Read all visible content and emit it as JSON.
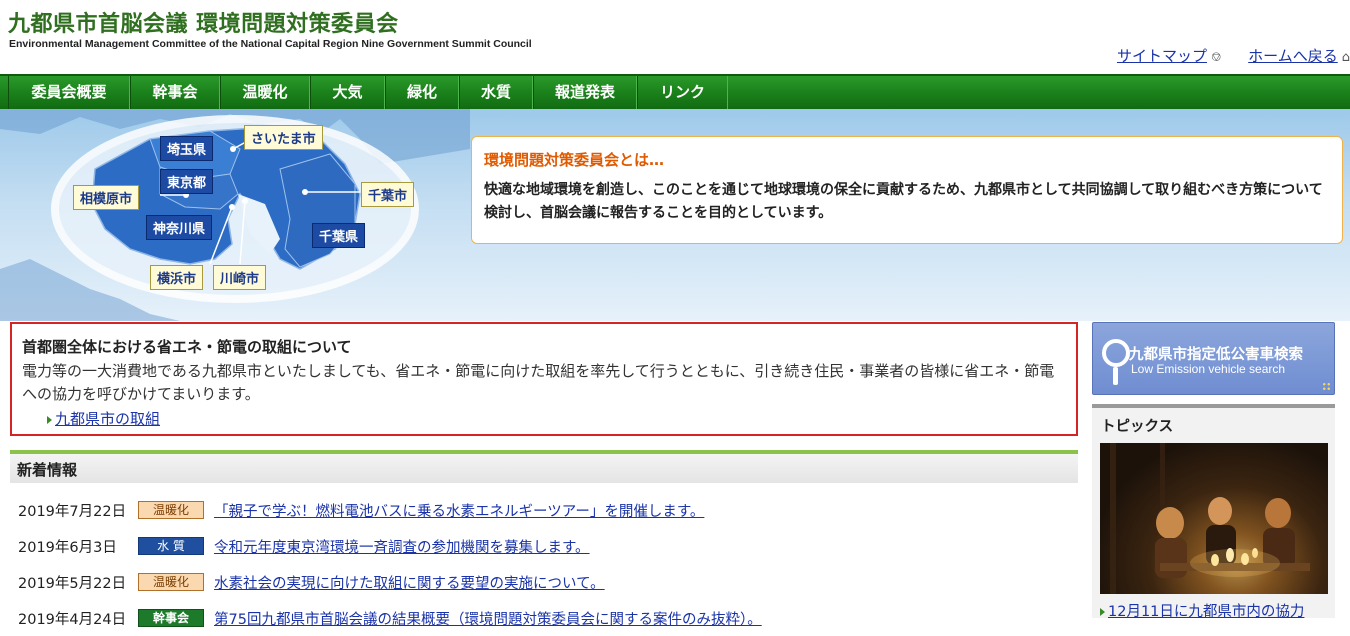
{
  "header": {
    "title": "九都県市首脳会議 環境問題対策委員会",
    "subtitle": "Environmental Management Committee of the National Capital Region Nine Government Summit Council",
    "sitemap_label": "サイトマップ",
    "home_label": "ホームへ戻る"
  },
  "nav": {
    "items": [
      "委員会概要",
      "幹事会",
      "温暖化",
      "大気",
      "緑化",
      "水質",
      "報道発表",
      "リンク"
    ]
  },
  "map": {
    "labels": {
      "saitama_pref": "埼玉県",
      "saitama_city": "さいたま市",
      "tokyo": "東京都",
      "sagamihara": "相模原市",
      "chiba_city": "千葉市",
      "kanagawa": "神奈川県",
      "chiba_pref": "千葉県",
      "yokohama": "横浜市",
      "kawasaki": "川崎市"
    }
  },
  "intro": {
    "title": "環境問題対策委員会とは…",
    "text": "快適な地域環境を創造し、このことを通じて地球環境の保全に貢献するため、九都県市として共同協調して取り組むべき方策について検討し、首脳会議に報告することを目的としています。"
  },
  "notice": {
    "title": "首都圏全体における省エネ・節電の取組について",
    "text": "電力等の一大消費地である九都県市といたしましても、省エネ・節電に向けた取組を率先して行うとともに、引き続き住民・事業者の皆様に省エネ・節電への協力を呼びかけてまいります。",
    "link": "九都県市の取組"
  },
  "news": {
    "header": "新着情報",
    "items": [
      {
        "date": "2019年7月22日",
        "tag": "温暖化",
        "tag_type": "warm",
        "title": "「親子で学ぶ！燃料電池バスに乗る水素エネルギーツアー」を開催します。"
      },
      {
        "date": "2019年6月3日",
        "tag": "水 質",
        "tag_type": "water",
        "title": "令和元年度東京湾環境一斉調査の参加機関を募集します。"
      },
      {
        "date": "2019年5月22日",
        "tag": "温暖化",
        "tag_type": "warm",
        "title": "水素社会の実現に向けた取組に関する要望の実施について。"
      },
      {
        "date": "2019年4月24日",
        "tag": "幹事会",
        "tag_type": "kanji",
        "title": "第75回九都県市首脳会議の結果概要（環境問題対策委員会に関する案件のみ抜粋）。"
      }
    ]
  },
  "sidebar": {
    "search_title": "九都県市指定低公害車検索",
    "search_sub": "Low Emission vehicle search",
    "topics_title": "トピックス",
    "topics_link": "12月11日に九都県市内の協力"
  }
}
